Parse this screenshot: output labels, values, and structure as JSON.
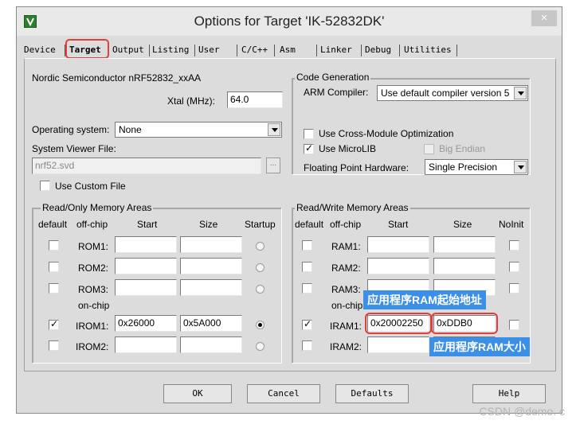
{
  "window": {
    "title": "Options for Target 'IK-52832DK'",
    "close_label": "×"
  },
  "tabs": [
    "Device",
    "Target",
    "Output",
    "Listing",
    "User",
    "C/C++",
    "Asm",
    "Linker",
    "Debug",
    "Utilities"
  ],
  "target": {
    "device_name": "Nordic Semiconductor nRF52832_xxAA",
    "xtal_label": "Xtal (MHz):",
    "xtal_value": "64.0",
    "os_label": "Operating system:",
    "os_value": "None",
    "svf_label": "System Viewer File:",
    "svf_value": "nrf52.svd",
    "browse_label": "...",
    "custom_file_label": "Use Custom File"
  },
  "code_gen": {
    "group_label": "Code Generation",
    "compiler_label": "ARM Compiler:",
    "compiler_value": "Use default compiler version 5",
    "cross_module_label": "Use Cross-Module Optimization",
    "microlib_label": "Use MicroLIB",
    "big_endian_label": "Big Endian",
    "fpu_label": "Floating Point Hardware:",
    "fpu_value": "Single Precision"
  },
  "ro_memory": {
    "group_label": "Read/Only Memory Areas",
    "headers": {
      "default": "default",
      "offchip": "off-chip",
      "start": "Start",
      "size": "Size",
      "startup": "Startup"
    },
    "onchip_label": "on-chip",
    "rows": [
      {
        "label": "ROM1:",
        "start": "",
        "size": ""
      },
      {
        "label": "ROM2:",
        "start": "",
        "size": ""
      },
      {
        "label": "ROM3:",
        "start": "",
        "size": ""
      },
      {
        "label": "IROM1:",
        "start": "0x26000",
        "size": "0x5A000"
      },
      {
        "label": "IROM2:",
        "start": "",
        "size": ""
      }
    ]
  },
  "rw_memory": {
    "group_label": "Read/Write Memory Areas",
    "headers": {
      "default": "default",
      "offchip": "off-chip",
      "start": "Start",
      "size": "Size",
      "noinit": "NoInit"
    },
    "onchip_label": "on-chip",
    "rows": [
      {
        "label": "RAM1:",
        "start": "",
        "size": ""
      },
      {
        "label": "RAM2:",
        "start": "",
        "size": ""
      },
      {
        "label": "RAM3:",
        "start": "",
        "size": ""
      },
      {
        "label": "IRAM1:",
        "start": "0x20002250",
        "size": "0xDDB0"
      },
      {
        "label": "IRAM2:",
        "start": "",
        "size": ""
      }
    ]
  },
  "annotations": {
    "ram_start_note": "应用程序RAM起始地址",
    "ram_size_note": "应用程序RAM大小"
  },
  "buttons": {
    "ok": "OK",
    "cancel": "Cancel",
    "defaults": "Defaults",
    "help": "Help"
  },
  "watermark": "CSDN @demo. c",
  "colors": {
    "highlight": "#e0403b",
    "callout": "#3b8fe6"
  }
}
